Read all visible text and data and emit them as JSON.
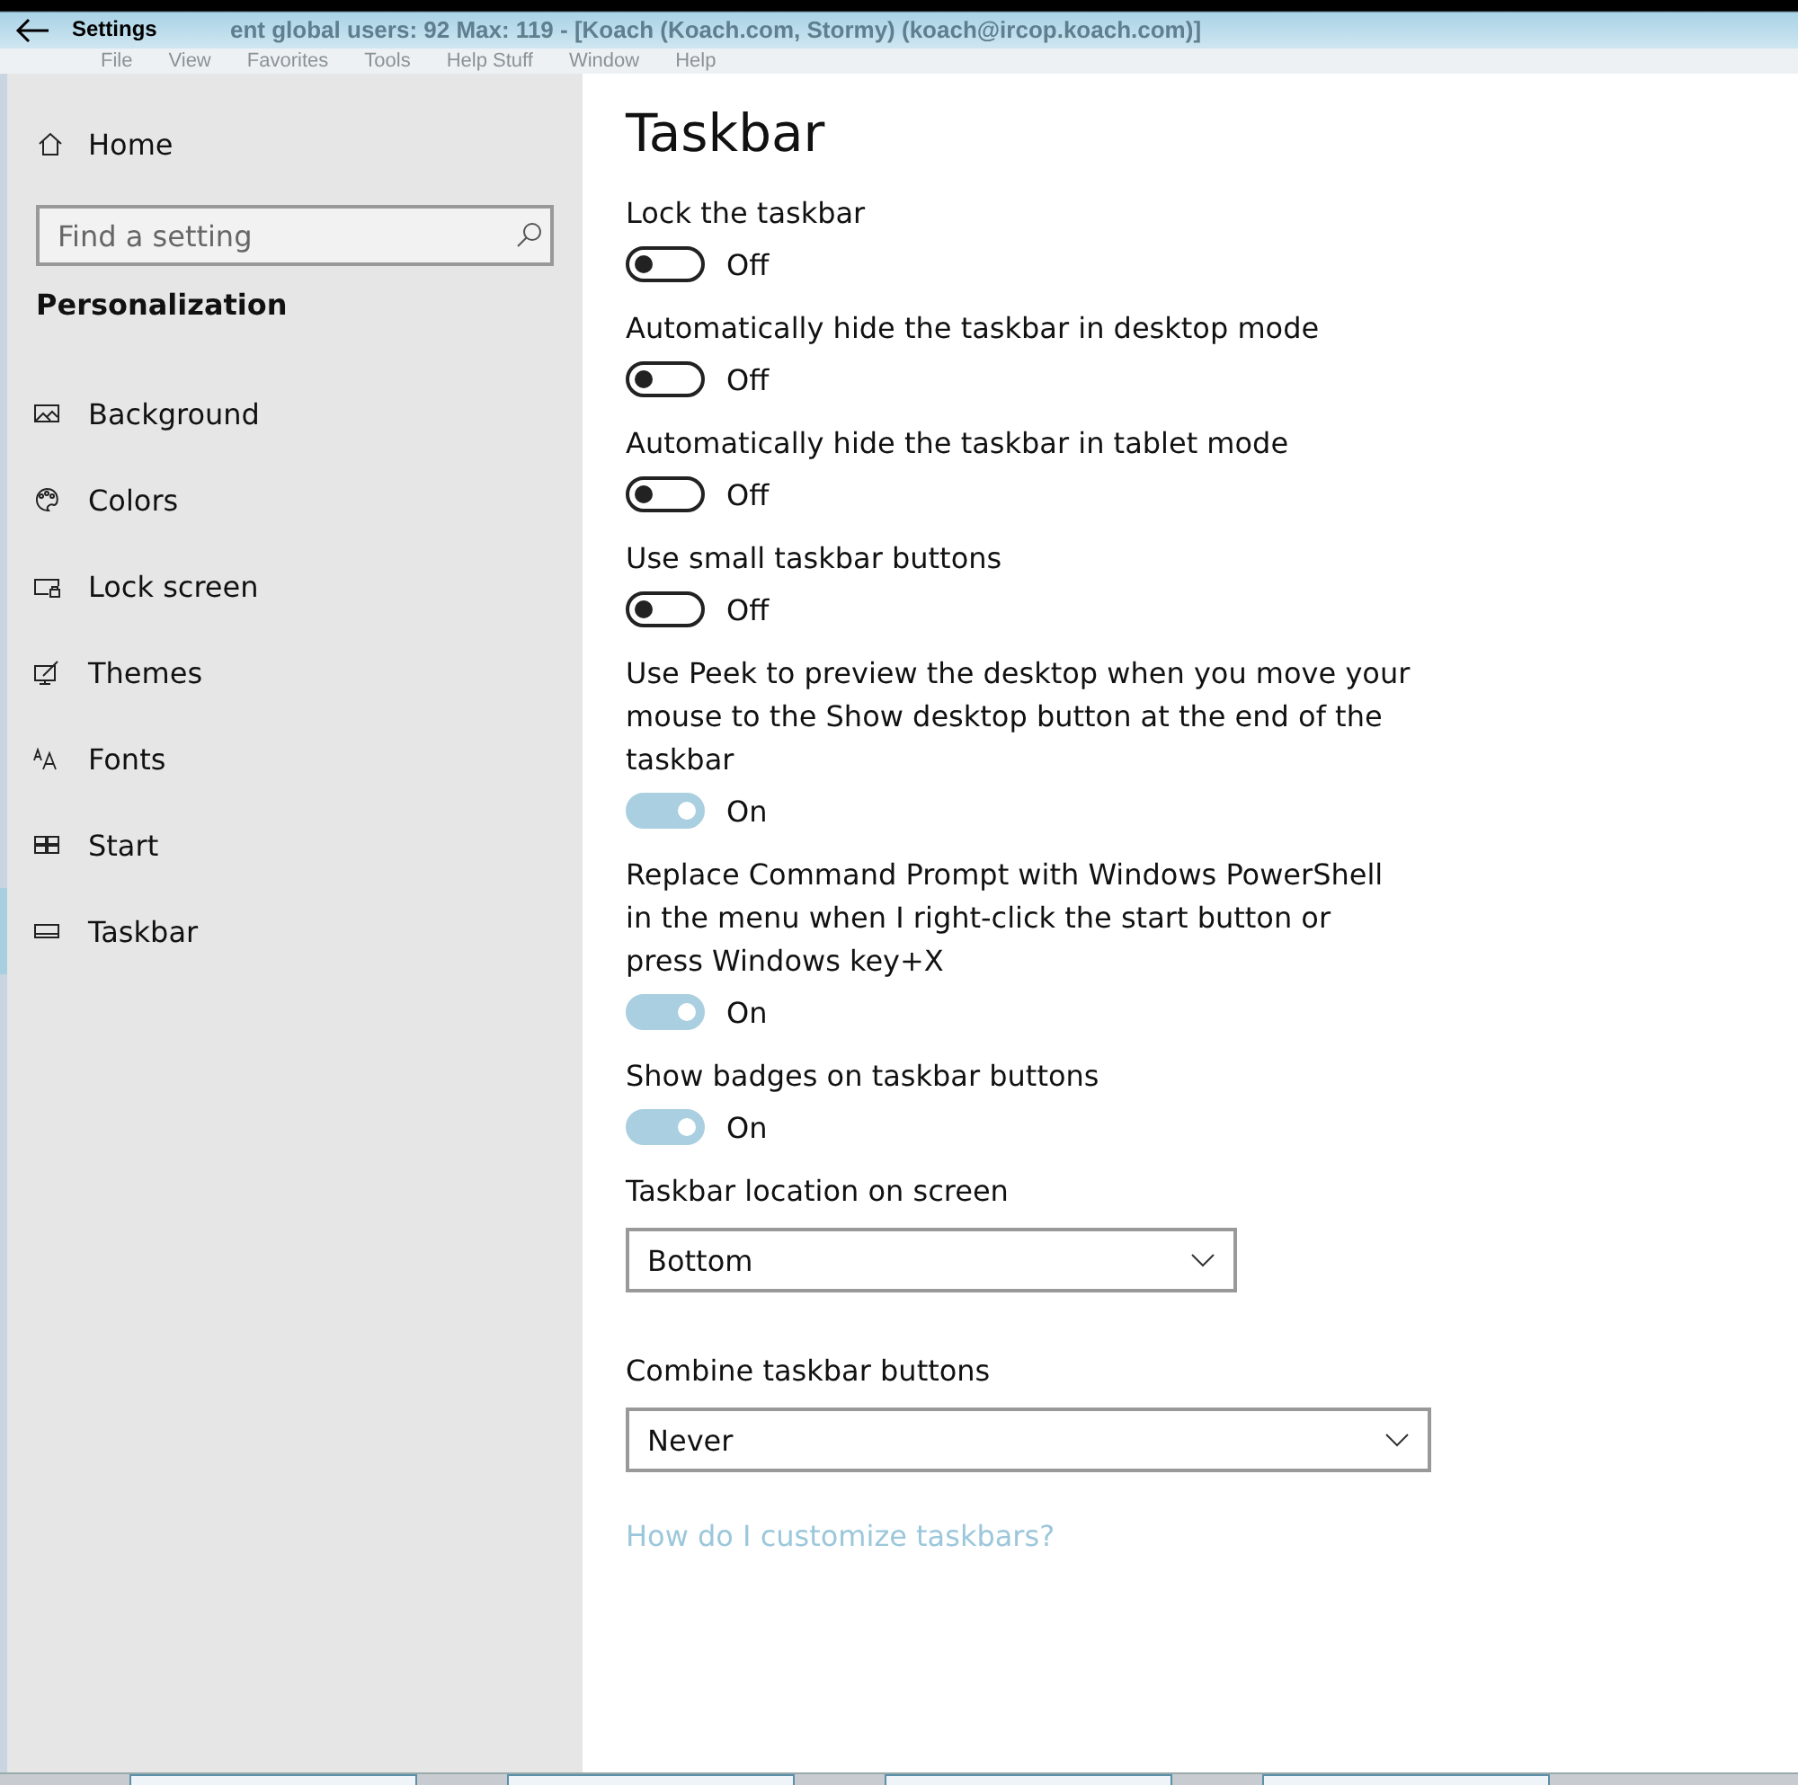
{
  "background_window": {
    "title": "ent global users: 92 Max: 119 - [Koach (Koach.com, Stormy) (koach@ircop.koach.com)]",
    "menu": [
      "File",
      "View",
      "Favorites",
      "Tools",
      "Help Stuff",
      "Window",
      "Help"
    ]
  },
  "window": {
    "title": "Settings"
  },
  "sidebar": {
    "home": "Home",
    "search": {
      "placeholder": "Find a setting"
    },
    "section": "Personalization",
    "items": [
      {
        "label": "Background",
        "selected": false
      },
      {
        "label": "Colors",
        "selected": false
      },
      {
        "label": "Lock screen",
        "selected": false
      },
      {
        "label": "Themes",
        "selected": false
      },
      {
        "label": "Fonts",
        "selected": false
      },
      {
        "label": "Start",
        "selected": false
      },
      {
        "label": "Taskbar",
        "selected": true
      }
    ]
  },
  "page": {
    "title": "Taskbar",
    "settings": [
      {
        "kind": "toggle",
        "label": "Lock the taskbar",
        "on": false,
        "state": "Off"
      },
      {
        "kind": "toggle",
        "label": "Automatically hide the taskbar in desktop mode",
        "on": false,
        "state": "Off"
      },
      {
        "kind": "toggle",
        "label": "Automatically hide the taskbar in tablet mode",
        "on": false,
        "state": "Off"
      },
      {
        "kind": "toggle",
        "label": "Use small taskbar buttons",
        "on": false,
        "state": "Off"
      },
      {
        "kind": "toggle",
        "label": "Use Peek to preview the desktop when you move your mouse to the Show desktop button at the end of the taskbar",
        "on": true,
        "state": "On"
      },
      {
        "kind": "toggle",
        "label": "Replace Command Prompt with Windows PowerShell in the menu when I right-click the start button or press Windows key+X",
        "on": true,
        "state": "On"
      },
      {
        "kind": "toggle",
        "label": "Show badges on taskbar buttons",
        "on": true,
        "state": "On"
      },
      {
        "kind": "dropdown",
        "label": "Taskbar location on screen",
        "value": "Bottom",
        "wide": false
      },
      {
        "kind": "dropdown",
        "label": "Combine taskbar buttons",
        "value": "Never",
        "wide": true
      }
    ],
    "link": "How do I customize taskbars?"
  }
}
